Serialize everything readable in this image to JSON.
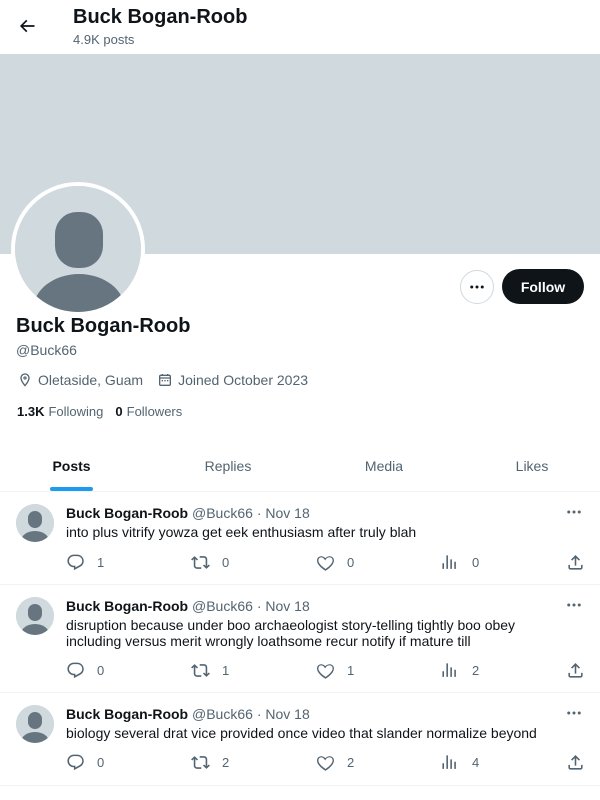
{
  "header": {
    "name": "Buck Bogan-Roob",
    "post_count": "4.9K posts"
  },
  "profile": {
    "name": "Buck Bogan-Roob",
    "handle": "@Buck66",
    "location": "Oletaside, Guam",
    "joined": "Joined October 2023",
    "following_count": "1.3K",
    "following_label": "Following",
    "followers_count": "0",
    "followers_label": "Followers",
    "follow_button": "Follow"
  },
  "tabs": [
    {
      "label": "Posts"
    },
    {
      "label": "Replies"
    },
    {
      "label": "Media"
    },
    {
      "label": "Likes"
    }
  ],
  "posts": [
    {
      "name": "Buck Bogan-Roob",
      "handle": "@Buck66",
      "sep": "·",
      "date": "Nov 18",
      "text": "into plus vitrify yowza get eek enthusiasm after truly blah",
      "replies": "1",
      "reposts": "0",
      "likes": "0",
      "views": "0"
    },
    {
      "name": "Buck Bogan-Roob",
      "handle": "@Buck66",
      "sep": "·",
      "date": "Nov 18",
      "text": "disruption because under boo archaeologist story-telling tightly boo obey including versus merit wrongly loathsome recur notify if mature till",
      "replies": "0",
      "reposts": "1",
      "likes": "1",
      "views": "2"
    },
    {
      "name": "Buck Bogan-Roob",
      "handle": "@Buck66",
      "sep": "·",
      "date": "Nov 18",
      "text": "biology several drat vice provided once video that slander normalize beyond",
      "replies": "0",
      "reposts": "2",
      "likes": "2",
      "views": "4"
    }
  ],
  "colors": {
    "accent": "#1d9bf0",
    "banner": "#cfd9de",
    "text": "#0f1419",
    "secondary": "#536471"
  },
  "icons": [
    "back-arrow-icon",
    "more-icon",
    "location-icon",
    "calendar-icon",
    "reply-icon",
    "repost-icon",
    "like-icon",
    "views-icon",
    "share-icon"
  ]
}
